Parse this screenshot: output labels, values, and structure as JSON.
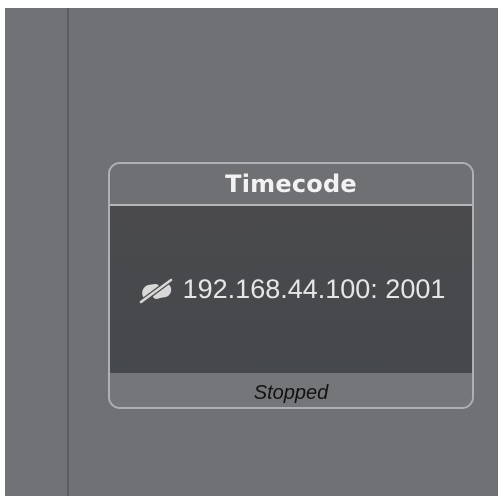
{
  "node": {
    "title": "Timecode",
    "address": "192.168.44.100: 2001",
    "status": "Stopped",
    "icon": "link-off-icon"
  },
  "colors": {
    "canvas": "#707175",
    "node_body": "#4a4a4c",
    "node_border": "#aeb0b4",
    "title_text": "#f2f2f2",
    "status_text": "#121212"
  }
}
